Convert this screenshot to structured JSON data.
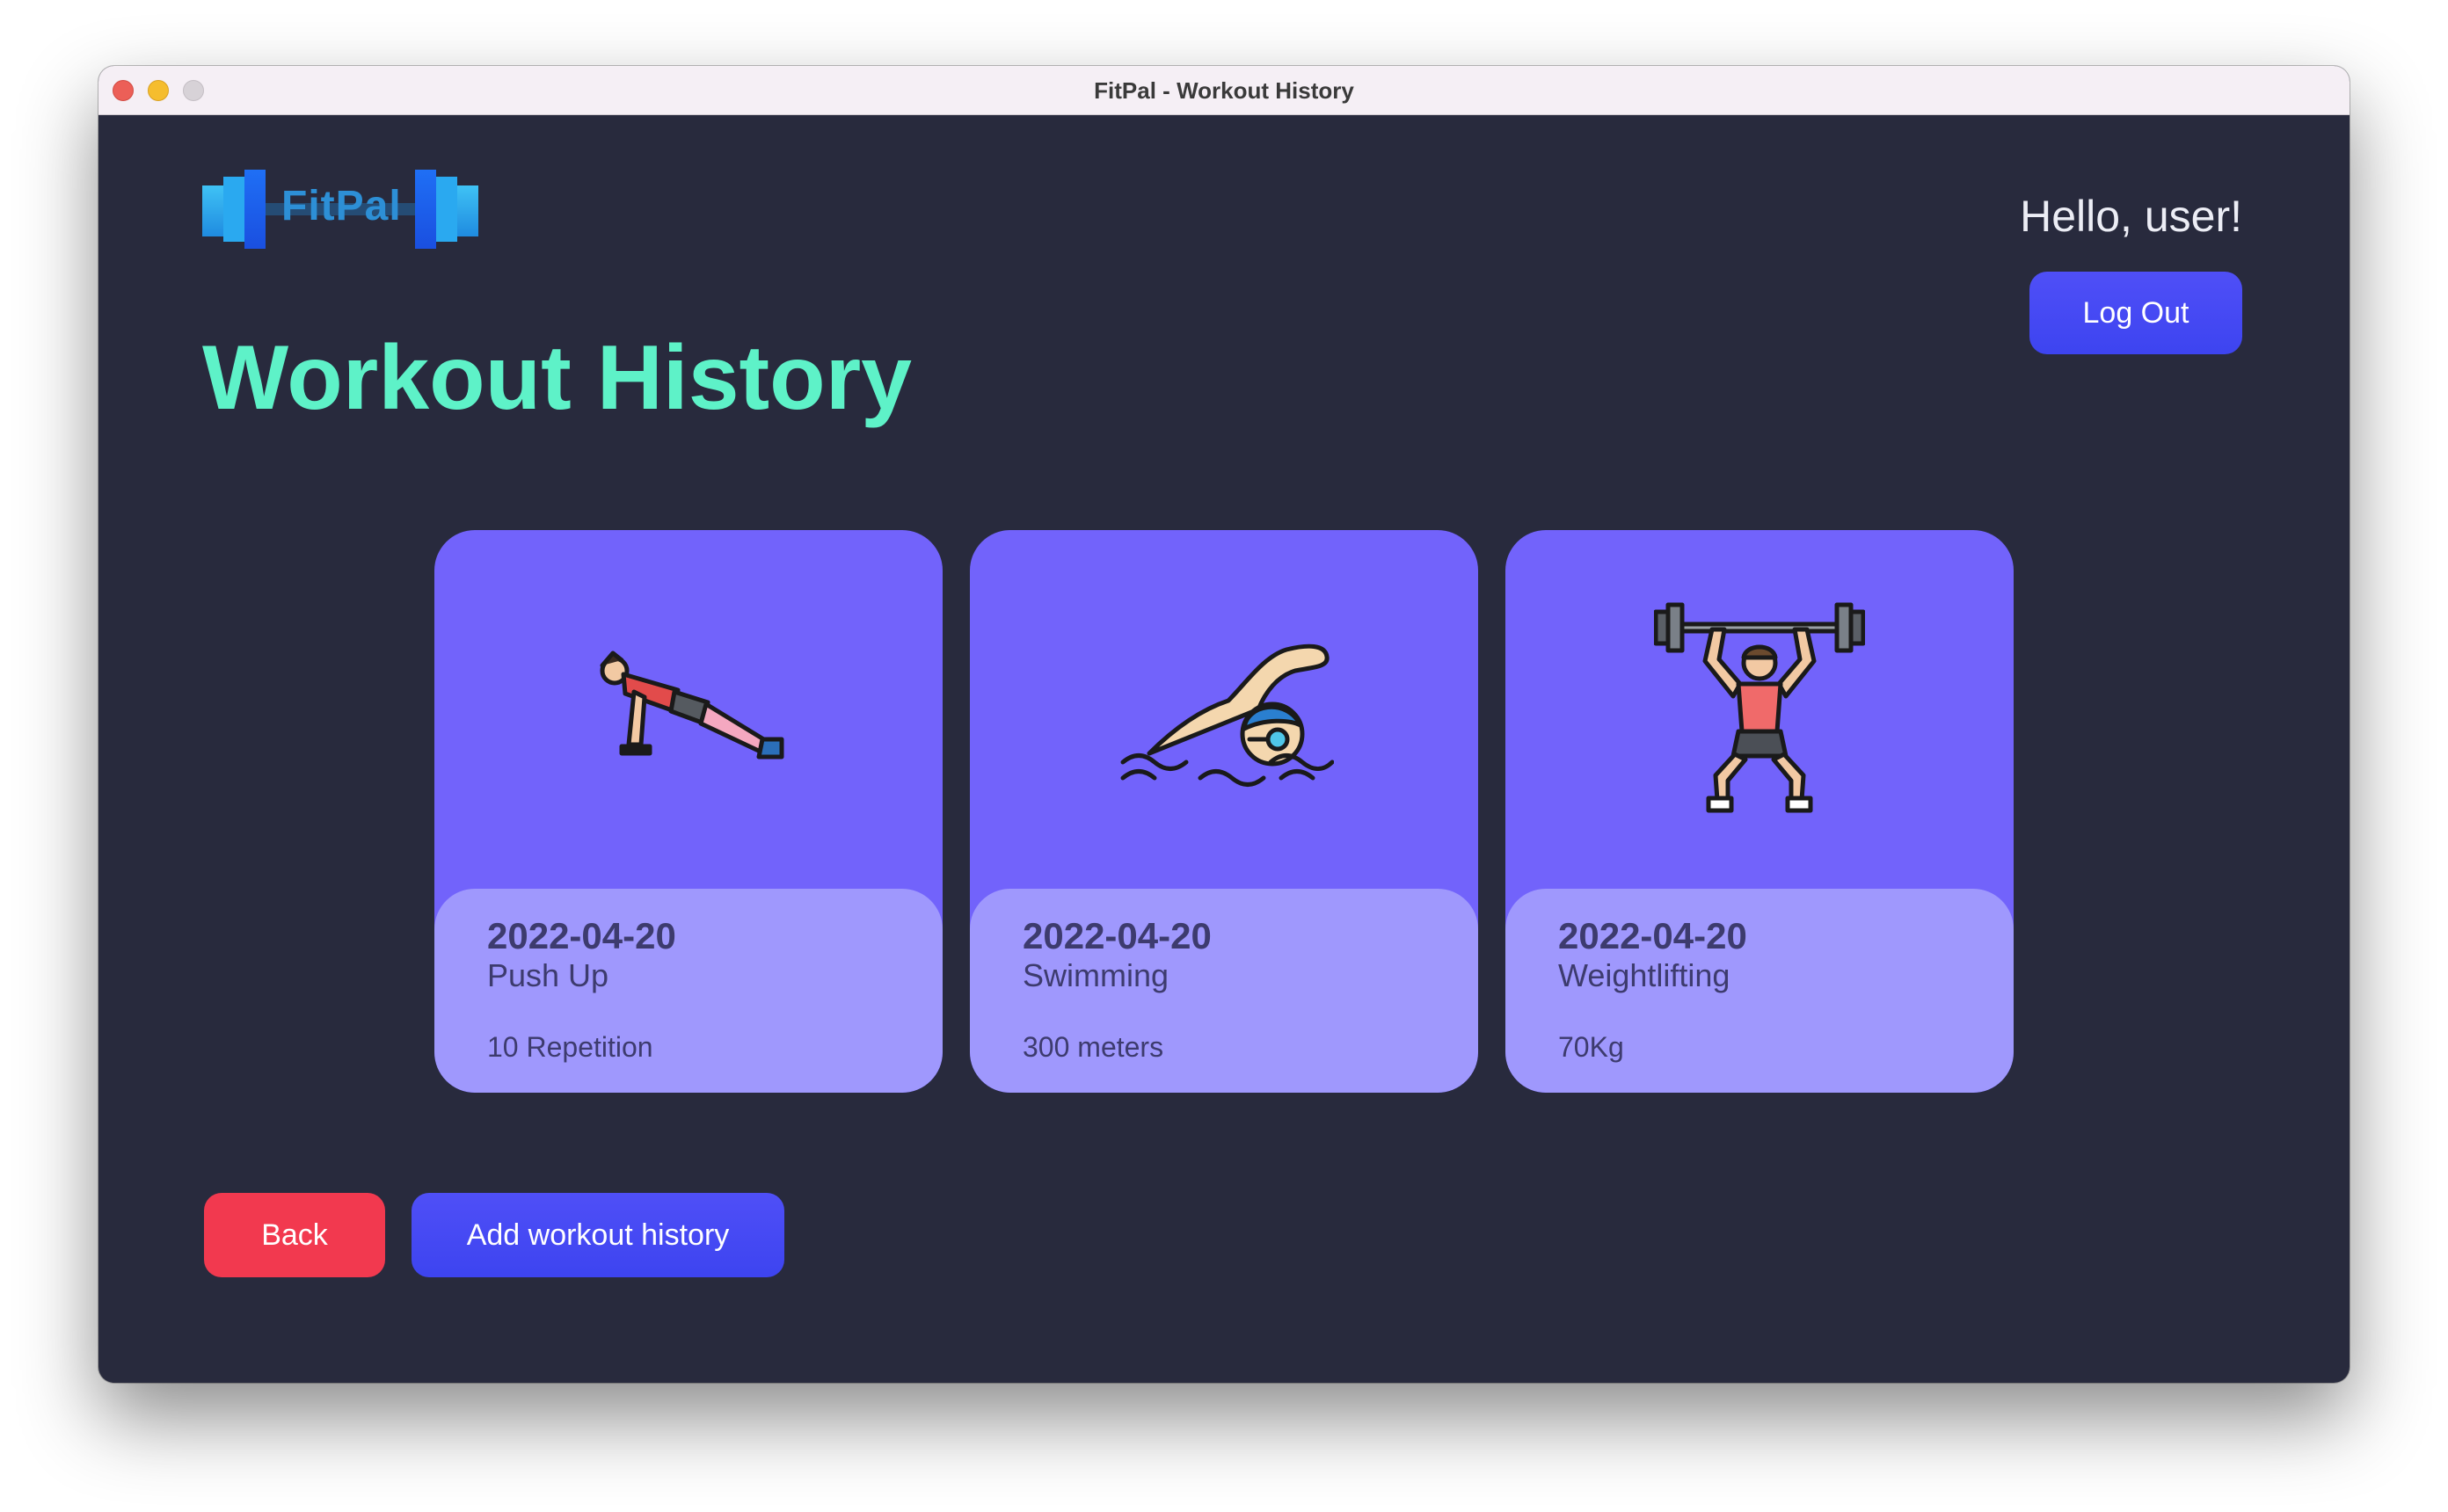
{
  "window": {
    "title": "FitPal - Workout History"
  },
  "header": {
    "logo_text": "FitPal",
    "greeting": "Hello, user!",
    "logout_label": "Log Out"
  },
  "page": {
    "title": "Workout History"
  },
  "workouts": [
    {
      "date": "2022-04-20",
      "name": "Push Up",
      "amount": "10 Repetition",
      "icon": "push-up-icon"
    },
    {
      "date": "2022-04-20",
      "name": "Swimming",
      "amount": "300 meters",
      "icon": "swimming-icon"
    },
    {
      "date": "2022-04-20",
      "name": "Weightlifting",
      "amount": "70Kg",
      "icon": "weightlifting-icon"
    }
  ],
  "footer": {
    "back_label": "Back",
    "add_label": "Add workout history"
  },
  "colors": {
    "background": "#282a3d",
    "accent_title": "#5ef2c8",
    "primary_button": "#4048f3",
    "danger_button": "#f2394f",
    "card_top": "#7263fb",
    "card_bottom": "#9f98fd"
  }
}
